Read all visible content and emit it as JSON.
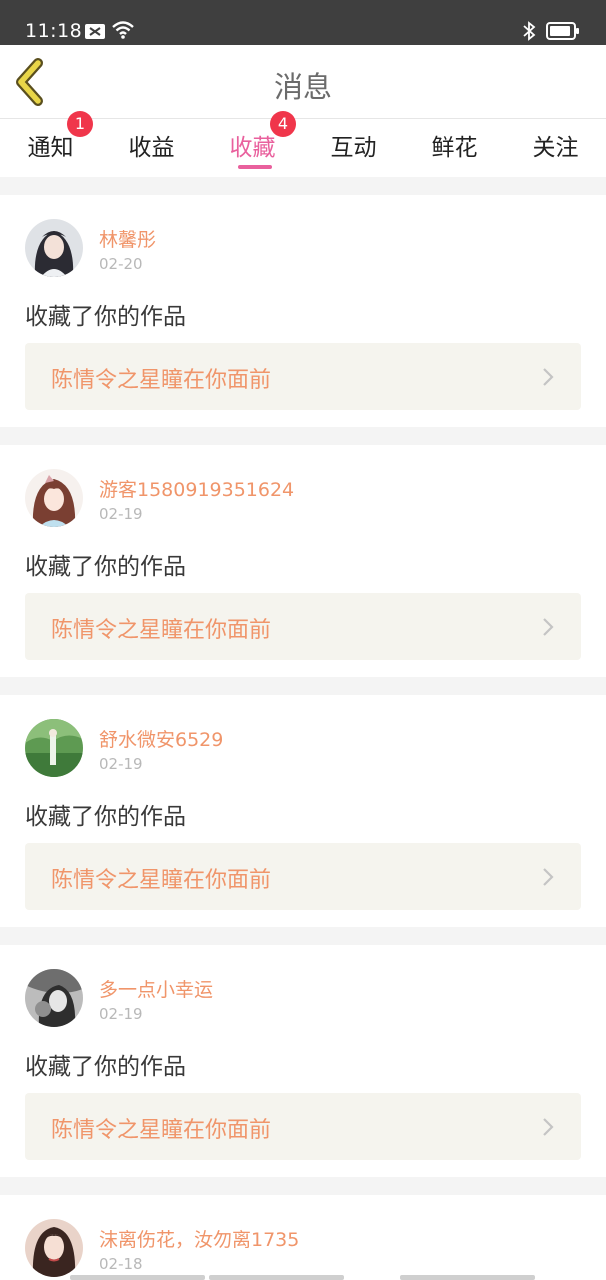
{
  "status_bar": {
    "time": "11:18"
  },
  "header": {
    "title": "消息"
  },
  "tabs": [
    {
      "label": "通知",
      "badge": "1",
      "active": false
    },
    {
      "label": "收益",
      "badge": "",
      "active": false
    },
    {
      "label": "收藏",
      "badge": "4",
      "active": true
    },
    {
      "label": "互动",
      "badge": "",
      "active": false
    },
    {
      "label": "鲜花",
      "badge": "",
      "active": false
    },
    {
      "label": "关注",
      "badge": "",
      "active": false
    }
  ],
  "messages": [
    {
      "user": "林馨彤",
      "date": "02-20",
      "action": "收藏了你的作品",
      "work": "陈情令之星瞳在你面前"
    },
    {
      "user": "游客1580919351624",
      "date": "02-19",
      "action": "收藏了你的作品",
      "work": "陈情令之星瞳在你面前"
    },
    {
      "user": "舒水微安6529",
      "date": "02-19",
      "action": "收藏了你的作品",
      "work": "陈情令之星瞳在你面前"
    },
    {
      "user": "多一点小幸运",
      "date": "02-19",
      "action": "收藏了你的作品",
      "work": "陈情令之星瞳在你面前"
    },
    {
      "user": "沫离伤花，汝勿离1735",
      "date": "02-18",
      "action": "",
      "work": ""
    }
  ],
  "colors": {
    "accent_pink": "#e9609d",
    "username_orange": "#f0956a",
    "badge_red": "#f0364b",
    "back_arrow_yellow": "#e8d548"
  }
}
